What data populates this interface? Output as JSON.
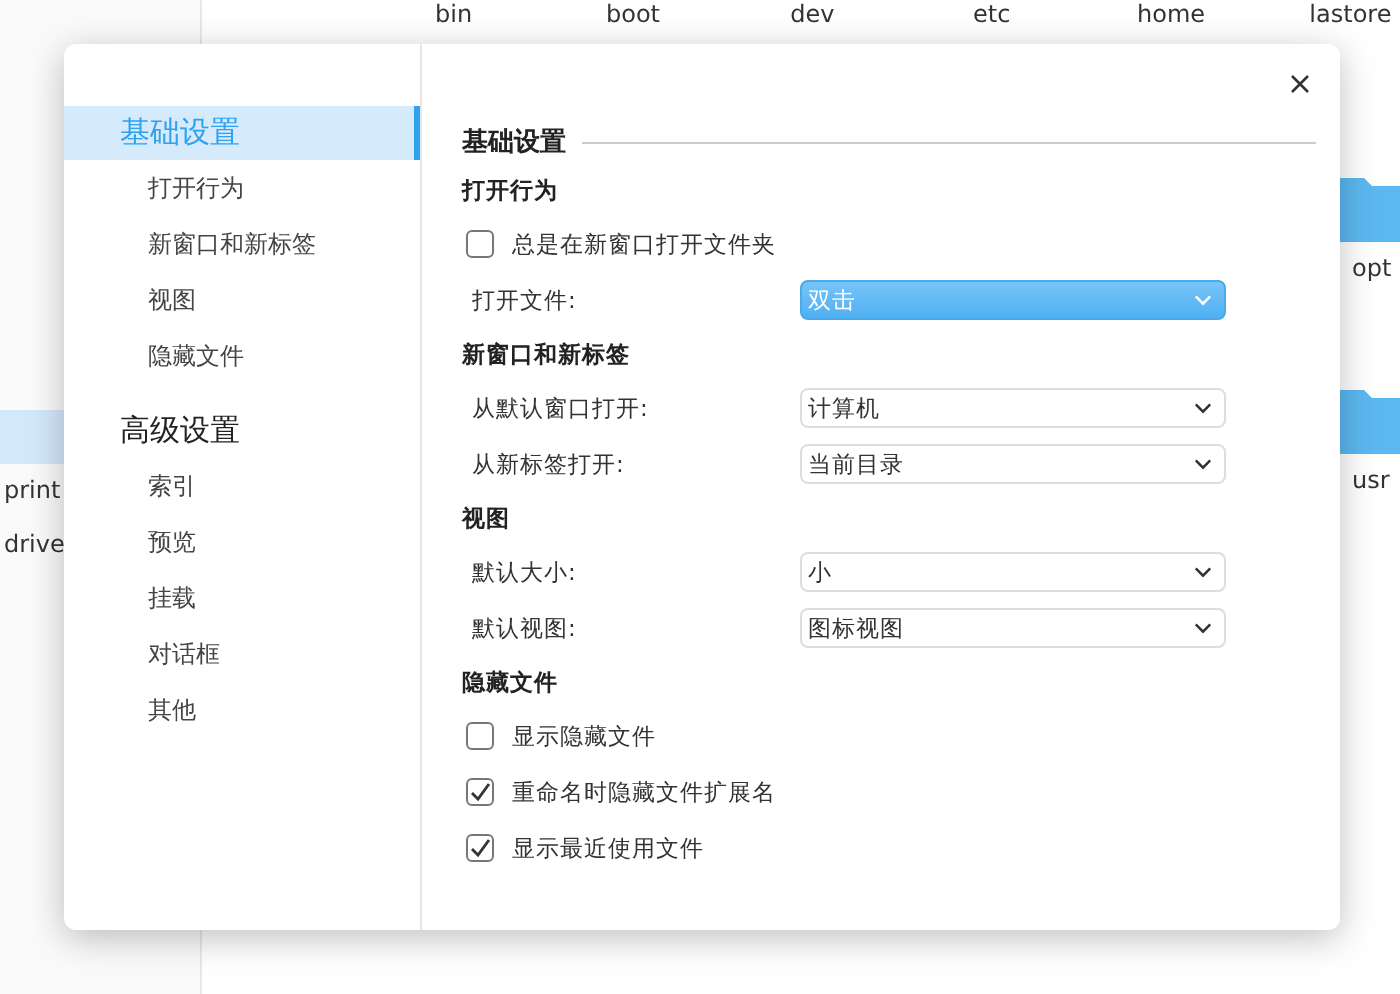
{
  "background_window": {
    "top_items": [
      "bin",
      "boot",
      "dev",
      "etc",
      "home",
      "lastore"
    ],
    "side_items": [
      {
        "selected": true
      },
      {
        "label": "print",
        "selected": false
      },
      {
        "label": "drive",
        "selected": false
      }
    ],
    "folders": [
      "opt",
      "usr"
    ]
  },
  "dialog": {
    "sidebar": [
      {
        "label": "基础设置",
        "selected": true,
        "items": [
          "打开行为",
          "新窗口和新标签",
          "视图",
          "隐藏文件"
        ]
      },
      {
        "label": "高级设置",
        "selected": false,
        "items": [
          "索引",
          "预览",
          "挂载",
          "对话框",
          "其他"
        ]
      }
    ],
    "title": "基础设置",
    "sections": [
      {
        "title": "打开行为",
        "rows": [
          {
            "kind": "checkbox",
            "label": "总是在新窗口打开文件夹",
            "checked": false
          },
          {
            "kind": "select",
            "label": "打开文件:",
            "value": "双击",
            "focused": true
          }
        ]
      },
      {
        "title": "新窗口和新标签",
        "rows": [
          {
            "kind": "select",
            "label": "从默认窗口打开:",
            "value": "计算机",
            "focused": false
          },
          {
            "kind": "select",
            "label": "从新标签打开:",
            "value": "当前目录",
            "focused": false
          }
        ]
      },
      {
        "title": "视图",
        "rows": [
          {
            "kind": "select",
            "label": "默认大小:",
            "value": "小",
            "focused": false
          },
          {
            "kind": "select",
            "label": "默认视图:",
            "value": "图标视图",
            "focused": false
          }
        ]
      },
      {
        "title": "隐藏文件",
        "rows": [
          {
            "kind": "checkbox",
            "label": "显示隐藏文件",
            "checked": false
          },
          {
            "kind": "checkbox",
            "label": "重命名时隐藏文件扩展名",
            "checked": true
          },
          {
            "kind": "checkbox",
            "label": "显示最近使用文件",
            "checked": true
          }
        ]
      }
    ]
  }
}
